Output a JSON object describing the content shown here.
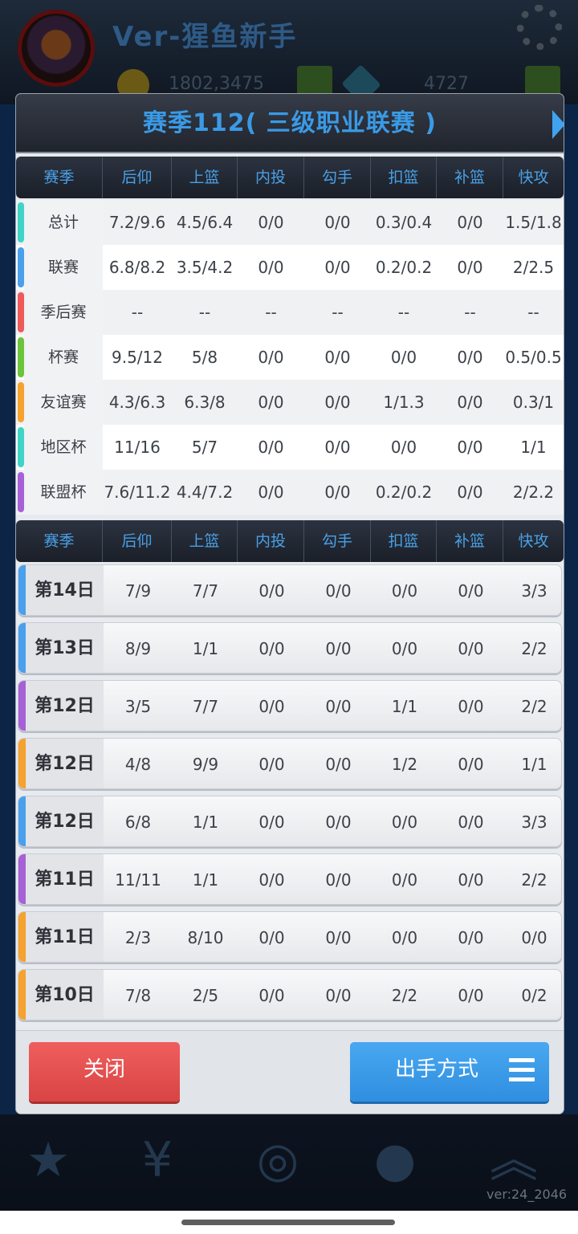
{
  "background": {
    "player_name": "Ver-猩鱼新手",
    "coins": "1802,3475",
    "gems": "4727",
    "version": "ver:24_2046"
  },
  "modal": {
    "title": "赛季112( 三级职业联赛 )",
    "headers": [
      "赛季",
      "后仰",
      "上篮",
      "内投",
      "勾手",
      "扣篮",
      "补篮",
      "快攻"
    ],
    "season_rows": [
      {
        "label": "总计",
        "accent": "#3fd4c6",
        "values": [
          "7.2/9.6",
          "4.5/6.4",
          "0/0",
          "0/0",
          "0.3/0.4",
          "0/0",
          "1.5/1.8"
        ]
      },
      {
        "label": "联赛",
        "accent": "#4aa0ec",
        "values": [
          "6.8/8.2",
          "3.5/4.2",
          "0/0",
          "0/0",
          "0.2/0.2",
          "0/0",
          "2/2.5"
        ]
      },
      {
        "label": "季后赛",
        "accent": "#ef5a5a",
        "values": [
          "--",
          "--",
          "--",
          "--",
          "--",
          "--",
          "--"
        ]
      },
      {
        "label": "杯赛",
        "accent": "#6cc43a",
        "values": [
          "9.5/12",
          "5/8",
          "0/0",
          "0/0",
          "0/0",
          "0/0",
          "0.5/0.5"
        ]
      },
      {
        "label": "友谊赛",
        "accent": "#f6a22e",
        "values": [
          "4.3/6.3",
          "6.3/8",
          "0/0",
          "0/0",
          "1/1.3",
          "0/0",
          "0.3/1"
        ]
      },
      {
        "label": "地区杯",
        "accent": "#3fd4c6",
        "values": [
          "11/16",
          "5/7",
          "0/0",
          "0/0",
          "0/0",
          "0/0",
          "1/1"
        ]
      },
      {
        "label": "联盟杯",
        "accent": "#a761d6",
        "values": [
          "7.6/11.2",
          "4.4/7.2",
          "0/0",
          "0/0",
          "0.2/0.2",
          "0/0",
          "2/2.2"
        ]
      }
    ],
    "game_rows": [
      {
        "label": "第14日",
        "accent": "#4aa0ec",
        "values": [
          "7/9",
          "7/7",
          "0/0",
          "0/0",
          "0/0",
          "0/0",
          "3/3"
        ]
      },
      {
        "label": "第13日",
        "accent": "#4aa0ec",
        "values": [
          "8/9",
          "1/1",
          "0/0",
          "0/0",
          "0/0",
          "0/0",
          "2/2"
        ]
      },
      {
        "label": "第12日",
        "accent": "#a761d6",
        "values": [
          "3/5",
          "7/7",
          "0/0",
          "0/0",
          "1/1",
          "0/0",
          "2/2"
        ]
      },
      {
        "label": "第12日",
        "accent": "#f6a22e",
        "values": [
          "4/8",
          "9/9",
          "0/0",
          "0/0",
          "1/2",
          "0/0",
          "1/1"
        ]
      },
      {
        "label": "第12日",
        "accent": "#4aa0ec",
        "values": [
          "6/8",
          "1/1",
          "0/0",
          "0/0",
          "0/0",
          "0/0",
          "3/3"
        ]
      },
      {
        "label": "第11日",
        "accent": "#a761d6",
        "values": [
          "11/11",
          "1/1",
          "0/0",
          "0/0",
          "0/0",
          "0/0",
          "2/2"
        ]
      },
      {
        "label": "第11日",
        "accent": "#f6a22e",
        "values": [
          "2/3",
          "8/10",
          "0/0",
          "0/0",
          "0/0",
          "0/0",
          "0/0"
        ]
      },
      {
        "label": "第10日",
        "accent": "#f6a22e",
        "values": [
          "7/8",
          "2/5",
          "0/0",
          "0/0",
          "2/2",
          "0/0",
          "0/2"
        ]
      }
    ],
    "footer": {
      "close_label": "关闭",
      "shot_mode_label": "出手方式"
    }
  }
}
